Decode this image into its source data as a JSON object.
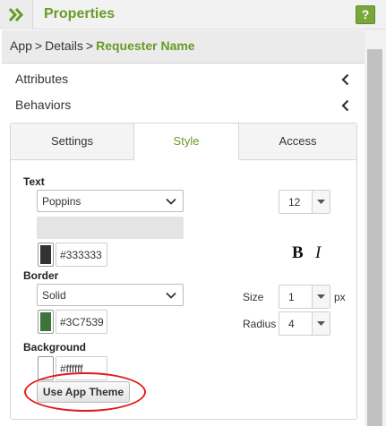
{
  "header": {
    "title": "Properties",
    "help_label": "?",
    "icon": "double-chevron-right-icon"
  },
  "breadcrumb": {
    "items": [
      "App",
      "Details"
    ],
    "separator": ">",
    "current": "Requester Name"
  },
  "sections": {
    "attributes": "Attributes",
    "behaviors": "Behaviors"
  },
  "tabs": {
    "settings": "Settings",
    "style": "Style",
    "access": "Access",
    "active": "Style"
  },
  "text": {
    "label": "Text",
    "font": "Poppins",
    "color_hex": "#333333",
    "font_size": "12",
    "bold_label": "B",
    "italic_label": "I"
  },
  "border": {
    "label": "Border",
    "style": "Solid",
    "color_hex": "#3C7539",
    "size_label": "Size",
    "size": "1",
    "size_unit": "px",
    "radius_label": "Radius",
    "radius": "4"
  },
  "background": {
    "label": "Background",
    "color_hex": "#ffffff",
    "theme_button": "Use App Theme"
  },
  "colors": {
    "accent": "#6b9a28",
    "highlight": "#e01b1b",
    "text_swatch": "#333333",
    "border_swatch": "#3C7539",
    "background_swatch": "#ffffff"
  }
}
